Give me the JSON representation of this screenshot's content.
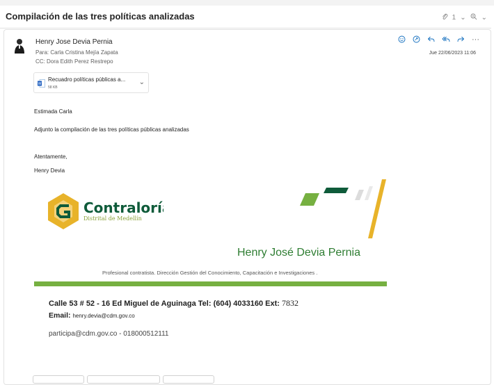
{
  "subject": "Compilación de las tres políticas analizadas",
  "subject_tools": {
    "attachment_count": "1"
  },
  "message": {
    "sender": "Henry Jose Devia Pernia",
    "to_label": "Para:",
    "to": "Carla Cristina Mejía Zapata",
    "cc_label": "CC:",
    "cc": "Dora Edith Perez Restrepo",
    "date": "Jue 22/06/2023 11:06"
  },
  "attachment": {
    "name": "Recuadro políticas públicas a...",
    "size": "58 KB"
  },
  "body": {
    "greeting": "Estimada Carla",
    "line1": "Adjunto la compilación de las tres políticas públicas analizadas",
    "closing": "Atentamente,",
    "name": "Henry Devia"
  },
  "signature": {
    "logo_title": "Contraloría",
    "logo_subtitle": "Distrital de Medellín",
    "full_name": "Henry José Devia Pernia",
    "role": "Profesional contratista. Dirección Gestión del Conocimiento, Capacitación e Investigaciones .",
    "address": "Calle 53 # 52 - 16 Ed Miguel de Aguinaga Tel: (604) 4033160 Ext:",
    "ext": "7832",
    "email_label": "Email:",
    "email": "henry.devia@cdm.gov.co",
    "participa": "participa@cdm.gov.co - 018000512111"
  },
  "colors": {
    "accent": "#0f6cbd",
    "green": "#76b041",
    "gold": "#e8b32a",
    "dark_green": "#0f5b3a"
  },
  "icons": [
    "attach-icon",
    "zoom-icon",
    "emoji-icon",
    "share-icon",
    "reply-icon",
    "reply-all-icon",
    "forward-icon",
    "more-icon",
    "word-file-icon",
    "chevron-down-icon"
  ]
}
